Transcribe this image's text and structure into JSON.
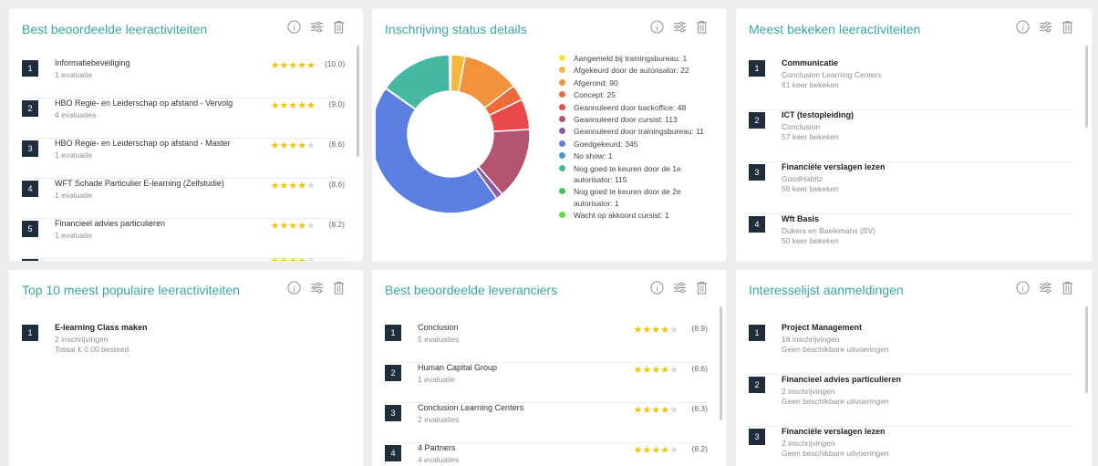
{
  "card1": {
    "title": "Best beoordeelde leeractiviteiten",
    "items": [
      {
        "rank": "1",
        "name": "Informatiebeveiliging",
        "sub": "1 evaluatie",
        "stars": 5,
        "score": "(10.0)"
      },
      {
        "rank": "2",
        "name": "HBO Regie- en Leiderschap op afstand - Vervolg",
        "sub": "4 evaluaties",
        "stars": 5,
        "score": "(9.0)"
      },
      {
        "rank": "3",
        "name": "HBO Regie- en Leiderschap op afstand - Master",
        "sub": "1 evaluatie",
        "stars": 4,
        "score": "(8.6)"
      },
      {
        "rank": "4",
        "name": "WFT Schade Particulier E-learning (Zelfstudie)",
        "sub": "1 evaluatie",
        "stars": 4,
        "score": "(8.6)"
      },
      {
        "rank": "5",
        "name": "Financieel advies particulieren",
        "sub": "1 evaluatie",
        "stars": 4,
        "score": "(8.2)"
      }
    ]
  },
  "card2": {
    "title": "Inschrijving status details",
    "legend": [
      {
        "label": "Aangemeld bij trainingsbureau: 1",
        "color": "#f4e23c",
        "value": 1
      },
      {
        "label": "Afgekeurd door de autorisator: 22",
        "color": "#f5b83d",
        "value": 22
      },
      {
        "label": "Afgerond: 90",
        "color": "#f2923d",
        "value": 90
      },
      {
        "label": "Concept: 25",
        "color": "#ef6a3d",
        "value": 25
      },
      {
        "label": "Geannuleerd door backoffice: 48",
        "color": "#e8484a",
        "value": 48
      },
      {
        "label": "Geannuleerd door cursist: 113",
        "color": "#b5546f",
        "value": 113
      },
      {
        "label": "Geannuleerd door trainingsbureau: 11",
        "color": "#8e5aa6",
        "value": 11
      },
      {
        "label": "Goedgekeurd: 345",
        "color": "#5a7fe0",
        "value": 345
      },
      {
        "label": "No show: 1",
        "color": "#4b9ad6",
        "value": 1
      },
      {
        "label": "Nog goed te keuren door de 1e autorisator: 115",
        "color": "#45b8a2",
        "value": 115
      },
      {
        "label": "Nog goed te keuren door de 2e autorisator: 1",
        "color": "#3ec75a",
        "value": 1
      },
      {
        "label": "Wacht op akkoord cursist: 1",
        "color": "#5ee03c",
        "value": 1
      }
    ]
  },
  "card3": {
    "title": "Meest bekeken leeractiviteiten",
    "items": [
      {
        "rank": "1",
        "name": "Communicatie",
        "sub1": "Conclusion Learning Centers",
        "sub2": "61 keer bekeken"
      },
      {
        "rank": "2",
        "name": "ICT (testopleiding)",
        "sub1": "Conclusion",
        "sub2": "57 keer bekeken"
      },
      {
        "rank": "3",
        "name": "Financiële verslagen lezen",
        "sub1": "GoodHabitz",
        "sub2": "56 keer bekeken"
      },
      {
        "rank": "4",
        "name": "Wft Basis",
        "sub1": "Dukers en Baelemans (BV)",
        "sub2": "50 keer bekeken"
      }
    ]
  },
  "card4": {
    "title": "Top 10 meest populaire leeractiviteiten",
    "items": [
      {
        "rank": "1",
        "name": "E-learning Class maken",
        "sub1": "2 inschrijvingen",
        "sub2": "Totaal € 0.00 besteed"
      }
    ]
  },
  "card5": {
    "title": "Best beoordeelde leveranciers",
    "items": [
      {
        "rank": "1",
        "name": "Conclusion",
        "sub": "5 evaluaties",
        "stars": 4,
        "score": "(8.9)"
      },
      {
        "rank": "2",
        "name": "Human Capital Group",
        "sub": "1 evaluatie",
        "stars": 4,
        "score": "(8.6)"
      },
      {
        "rank": "3",
        "name": "Conclusion Learning Centers",
        "sub": "2 evaluaties",
        "stars": 4,
        "score": "(8.3)"
      },
      {
        "rank": "4",
        "name": "4 Partners",
        "sub": "4 evaluaties",
        "stars": 4,
        "score": "(8.2)"
      }
    ]
  },
  "card6": {
    "title": "Interesselijst aanmeldingen",
    "items": [
      {
        "rank": "1",
        "name": "Project Management",
        "sub1": "18 inschrijvingen",
        "sub2": "Geen beschikbare uitvoeringen"
      },
      {
        "rank": "2",
        "name": "Financieel advies particulieren",
        "sub1": "2 inschrijvingen",
        "sub2": "Geen beschikbare uitvoeringen"
      },
      {
        "rank": "3",
        "name": "Financiële verslagen lezen",
        "sub1": "2 inschrijvingen",
        "sub2": "Geen beschikbare uitvoeringen"
      }
    ]
  },
  "icons": {
    "info": "info-icon",
    "settings": "sliders-icon",
    "delete": "trash-icon"
  },
  "colors": {
    "accent": "#3aa6a0",
    "rank_bg": "#1f2d3d",
    "star": "#f1c40f"
  }
}
